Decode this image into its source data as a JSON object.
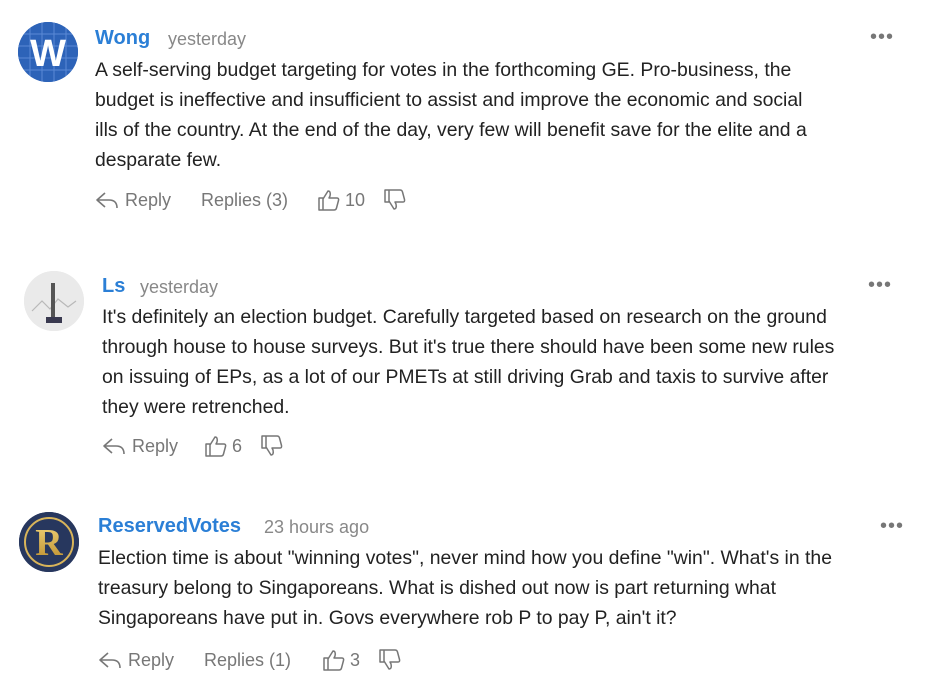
{
  "comments": [
    {
      "author": "Wong",
      "time": "yesterday",
      "text": "A self-serving budget targeting for votes in the forthcoming GE. Pro-business, the\nbudget is ineffective and insufficient to assist and improve the economic and social\nills of the country. At the end of the day, very few will benefit save for the elite and a\ndesparate few.",
      "reply_label": "Reply",
      "replies_label": "Replies (3)",
      "likes": "10",
      "avatar_letter": "W",
      "more": "•••"
    },
    {
      "author": "Ls",
      "time": "yesterday",
      "text": "It's definitely an election budget. Carefully targeted based on research on the ground\nthrough house to house surveys. But it's true there should have been some new rules\non issuing of EPs, as a lot of our PMETs at still driving Grab and taxis to survive after\nthey were retrenched.",
      "reply_label": "Reply",
      "likes": "6",
      "more": "•••"
    },
    {
      "author": "ReservedVotes",
      "time": "23 hours ago",
      "text": "Election time is about \"winning votes\", never mind how you define \"win\". What's in the\ntreasury belong to Singaporeans. What is dished out now is part returning what\nSingaporeans have put in. Govs everywhere rob P to pay P, ain't it?",
      "reply_label": "Reply",
      "replies_label": "Replies (1)",
      "likes": "3",
      "avatar_letter": "R",
      "more": "•••"
    }
  ],
  "colors": {
    "author": "#2b7fd6",
    "meta": "#888888",
    "text": "#222222",
    "action": "#777777"
  }
}
